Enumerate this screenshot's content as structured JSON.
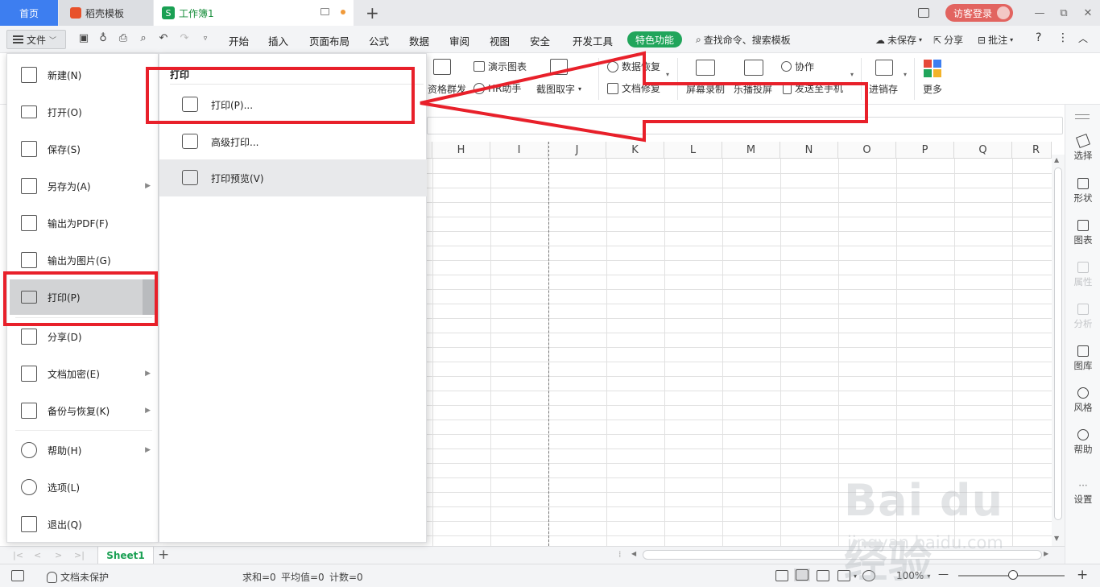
{
  "titlebar": {
    "tab_home": "首页",
    "tab_docer": "稻壳模板",
    "tab_book": "工作簿1",
    "tab_book_logo": "S",
    "new_tab": "+",
    "login": "访客登录",
    "win_min": "—",
    "win_max": "⧉",
    "win_close": "✕"
  },
  "menubar": {
    "file": "文件",
    "items": [
      "开始",
      "插入",
      "页面布局",
      "公式",
      "数据",
      "审阅",
      "视图",
      "安全",
      "开发工具"
    ],
    "special": "特色功能",
    "search": "查找命令、搜索模板",
    "unsaved": "未保存",
    "share": "分享",
    "comment": "批注",
    "help": "?",
    "more": "⋮",
    "collapse": "︿"
  },
  "ribbon": {
    "resource_send": "资格群发",
    "demo_chart": "演示图表",
    "hr_helper": "HR助手",
    "screenshot_text": "截图取字",
    "data_recovery": "数据恢复",
    "doc_repair": "文档修复",
    "screen_record": "屏幕录制",
    "screen_cast": "乐播投屏",
    "collab": "协作",
    "send_phone": "发送至手机",
    "incremental_save": "进销存",
    "more": "更多"
  },
  "grid": {
    "columns": [
      "H",
      "I",
      "J",
      "K",
      "L",
      "M",
      "N",
      "O",
      "P",
      "Q",
      "R"
    ]
  },
  "sidepanel": {
    "items": [
      {
        "label": "选择",
        "icon": "cursor-icon",
        "enabled": true
      },
      {
        "label": "形状",
        "icon": "shapes-icon",
        "enabled": true
      },
      {
        "label": "图表",
        "icon": "chart-icon",
        "enabled": true
      },
      {
        "label": "属性",
        "icon": "properties-icon",
        "enabled": false
      },
      {
        "label": "分析",
        "icon": "analysis-icon",
        "enabled": false
      },
      {
        "label": "图库",
        "icon": "gallery-icon",
        "enabled": true
      },
      {
        "label": "风格",
        "icon": "style-icon",
        "enabled": true
      },
      {
        "label": "帮助",
        "icon": "help-icon",
        "enabled": true
      },
      {
        "label": "设置",
        "icon": "settings-icon",
        "enabled": true
      }
    ]
  },
  "sheetbar": {
    "sheet": "Sheet1",
    "add": "+"
  },
  "statusbar": {
    "protect": "文档未保护",
    "sum": "求和=0",
    "avg": "平均值=0",
    "count": "计数=0",
    "zoom": "100%",
    "zoom_out": "—",
    "zoom_in": "+"
  },
  "filemenu": {
    "items": [
      {
        "label": "新建(N)",
        "icon": "new-file-icon",
        "arrow": false
      },
      {
        "label": "打开(O)",
        "icon": "folder-icon",
        "arrow": false
      },
      {
        "label": "保存(S)",
        "icon": "save-icon",
        "arrow": false
      },
      {
        "label": "另存为(A)",
        "icon": "save-as-icon",
        "arrow": true
      },
      {
        "label": "输出为PDF(F)",
        "icon": "pdf-icon",
        "arrow": false
      },
      {
        "label": "输出为图片(G)",
        "icon": "image-export-icon",
        "arrow": false
      },
      {
        "label": "打印(P)",
        "icon": "printer-icon",
        "arrow": true
      },
      {
        "label": "分享(D)",
        "icon": "share-icon",
        "arrow": false
      },
      {
        "label": "文档加密(E)",
        "icon": "encrypt-icon",
        "arrow": true
      },
      {
        "label": "备份与恢复(K)",
        "icon": "backup-icon",
        "arrow": true
      },
      {
        "label": "帮助(H)",
        "icon": "help-icon",
        "arrow": true
      },
      {
        "label": "选项(L)",
        "icon": "gear-icon",
        "arrow": false
      },
      {
        "label": "退出(Q)",
        "icon": "exit-icon",
        "arrow": false
      }
    ]
  },
  "submenu": {
    "header": "打印",
    "items": [
      {
        "label": "打印(P)...",
        "icon": "printer-icon"
      },
      {
        "label": "高级打印...",
        "icon": "advanced-print-icon"
      },
      {
        "label": "打印预览(V)",
        "icon": "print-preview-icon"
      }
    ]
  },
  "watermark": {
    "main": "Bai du 经验",
    "url": "jingyan.baidu.com"
  },
  "colors": {
    "accent": "#3d7ef0",
    "green": "#21a55b",
    "annotation_red": "#e8202a"
  }
}
